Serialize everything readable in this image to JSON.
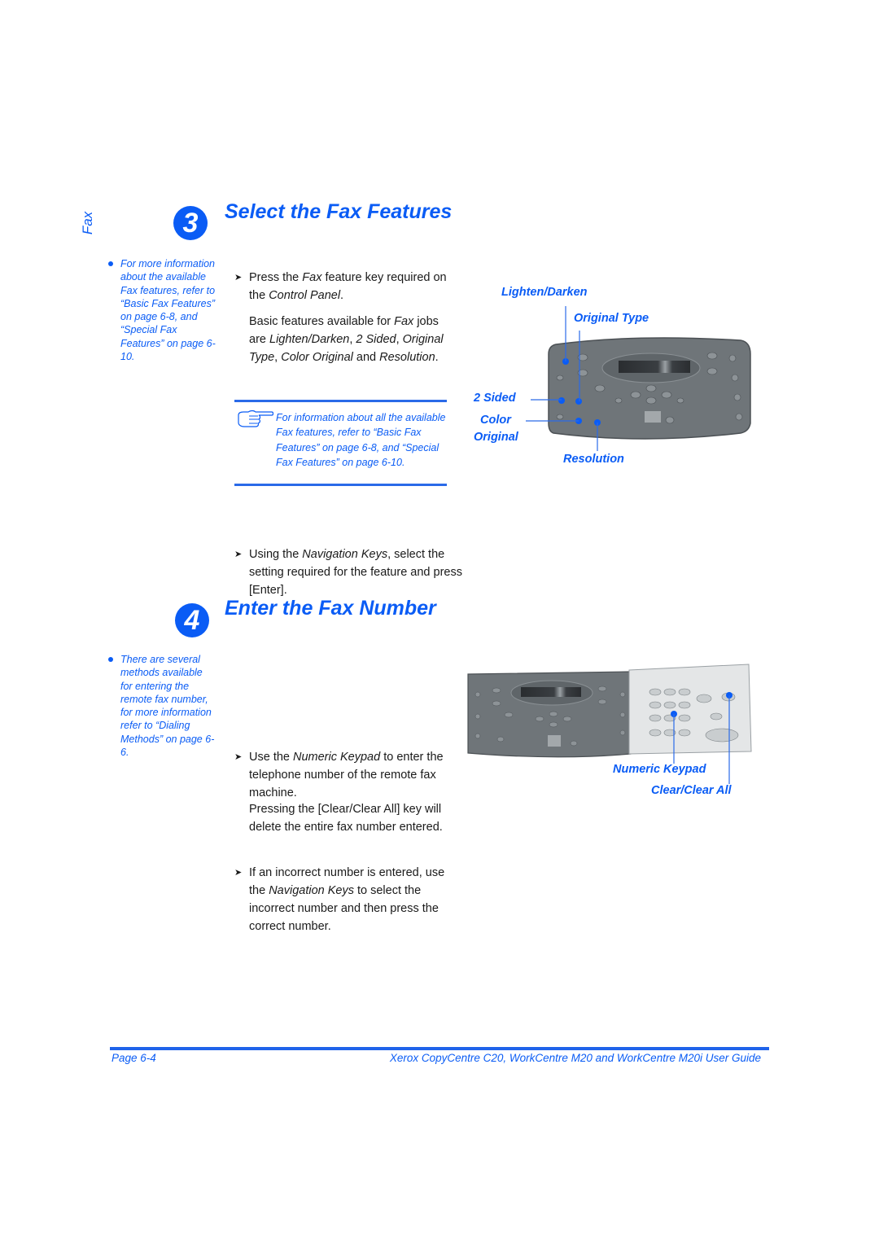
{
  "side_tab": {
    "label": "Fax"
  },
  "section3": {
    "number": "3",
    "title": "Select the Fax Features",
    "sidenote": "For more information about the available Fax features, refer to “Basic Fax Features” on page 6-8, and “Special Fax Features” on page 6-10.",
    "step1": {
      "pre": "Press the ",
      "em1": "Fax",
      "mid": " feature key required on the ",
      "em2": "Control Panel",
      "post": "."
    },
    "para": {
      "pre": "Basic features available for ",
      "em1": "Fax",
      "mid1": " jobs are ",
      "em2": "Lighten/Darken",
      "sep1": ", ",
      "em3": "2 Sided",
      "sep2": ", ",
      "em4": "Original Type",
      "sep3": ", ",
      "em5": "Color Original",
      "mid2": " and ",
      "em6": "Resolution",
      "post": "."
    },
    "note": "For information about all the available Fax features, refer to “Basic Fax Features” on page 6-8, and “Special Fax Features” on page 6-10.",
    "step2": {
      "pre": "Using the ",
      "em1": "Navigation Keys",
      "post": ", select the setting required for the feature and press [Enter]."
    },
    "callouts": {
      "lighten_darken": "Lighten/Darken",
      "original_type": "Original Type",
      "two_sided": "2 Sided",
      "color": "Color",
      "original": "Original",
      "resolution": "Resolution"
    }
  },
  "section4": {
    "number": "4",
    "title": "Enter the Fax Number",
    "sidenote": "There are several methods available for entering the remote fax number, for more information refer to “Dialing Methods” on page 6-6.",
    "step1": {
      "pre": "Use the ",
      "em1": "Numeric Keypad",
      "post": " to enter the telephone number of the remote fax machine."
    },
    "step2": {
      "pre": "If an incorrect number is entered, use the ",
      "em1": "Navigation Keys",
      "post": " to select the incorrect number and then press the correct number."
    },
    "para": "Pressing the [Clear/Clear All] key will delete the entire fax number entered.",
    "callouts": {
      "numeric_keypad": "Numeric Keypad",
      "clear_all": "Clear/Clear All"
    }
  },
  "footer": {
    "page": "Page 6-4",
    "guide_title": "Xerox CopyCentre C20, WorkCentre M20 and WorkCentre M20i User Guide"
  },
  "colors": {
    "accent": "#0a5cf5",
    "rule": "#1f63ea",
    "panel_dark": "#6f7579",
    "panel_light": "#e4e6e7"
  }
}
